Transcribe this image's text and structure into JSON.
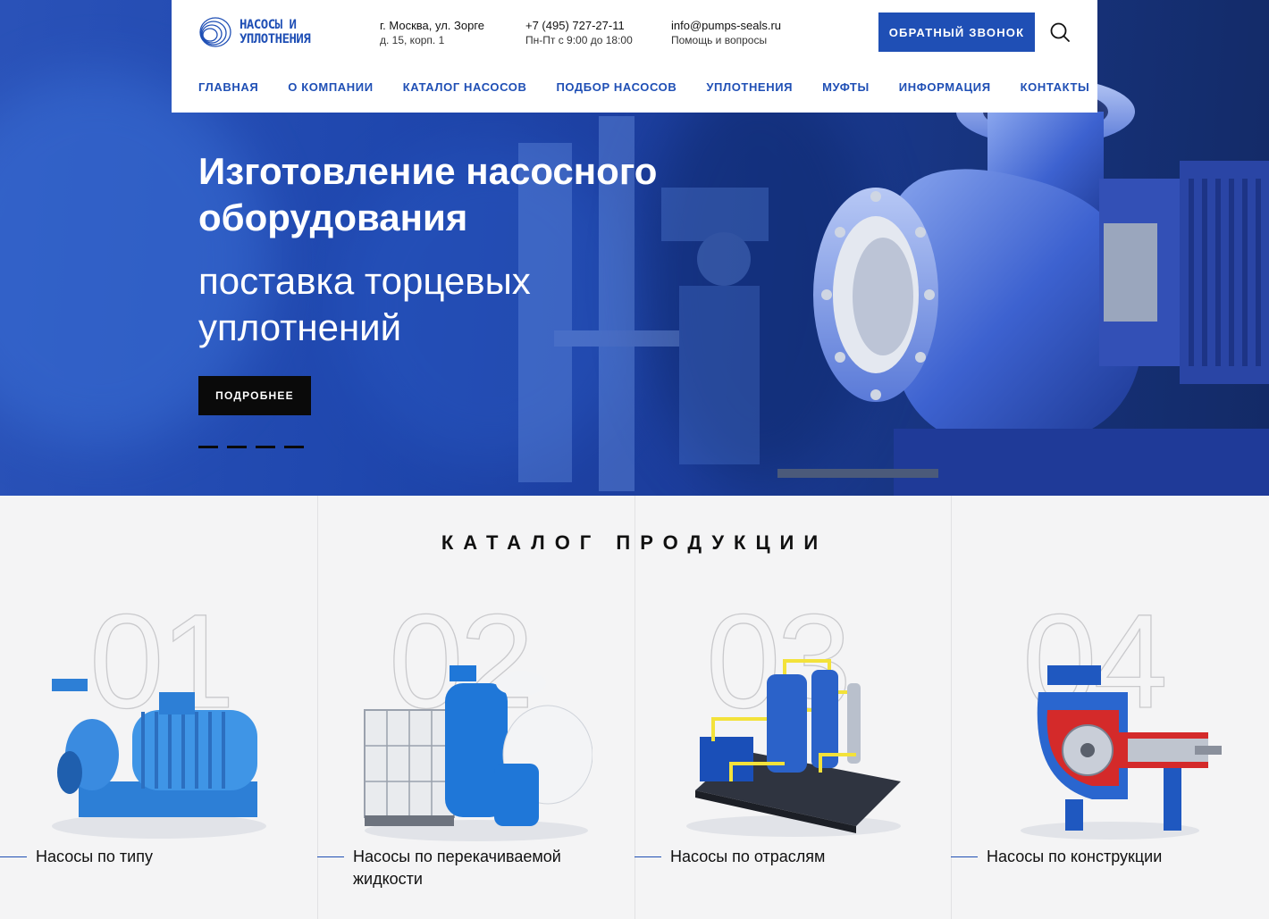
{
  "header": {
    "logo_line1": "НАСОСЫ И",
    "logo_line2": "УПЛОТНЕНИЯ",
    "address_main": "г. Москва, ул. Зорге",
    "address_sub": "д. 15, корп. 1",
    "phone_main": "+7 (495) 727-27-11",
    "phone_sub": "Пн-Пт с 9:00 до 18:00",
    "email_main": "info@pumps-seals.ru",
    "email_sub": "Помощь и вопросы",
    "callback_label": "ОБРАТНЫЙ ЗВОНОК",
    "search_icon": "search-icon"
  },
  "nav": {
    "items": [
      {
        "label": "ГЛАВНАЯ"
      },
      {
        "label": "О КОМПАНИИ"
      },
      {
        "label": "КАТАЛОГ НАСОСОВ"
      },
      {
        "label": "ПОДБОР НАСОСОВ"
      },
      {
        "label": "УПЛОТНЕНИЯ"
      },
      {
        "label": "МУФТЫ"
      },
      {
        "label": "ИНФОРМАЦИЯ"
      },
      {
        "label": "КОНТАКТЫ"
      }
    ]
  },
  "hero": {
    "title": "Изготовление насосного оборудования",
    "subtitle": "поставка торцевых уплотнений",
    "button_label": "ПОДРОБНЕЕ",
    "slides_count": 4
  },
  "catalog": {
    "title": "КАТАЛОГ ПРОДУКЦИИ",
    "cards": [
      {
        "number": "01",
        "label": "Насосы по типу"
      },
      {
        "number": "02",
        "label": "Насосы по перекачиваемой жидкости"
      },
      {
        "number": "03",
        "label": "Насосы по отраслям"
      },
      {
        "number": "04",
        "label": "Насосы по  конструкции"
      }
    ]
  },
  "colors": {
    "brand_blue": "#1f4fb5",
    "hero_blue": "#1f47ae",
    "black": "#0a0a0a"
  }
}
